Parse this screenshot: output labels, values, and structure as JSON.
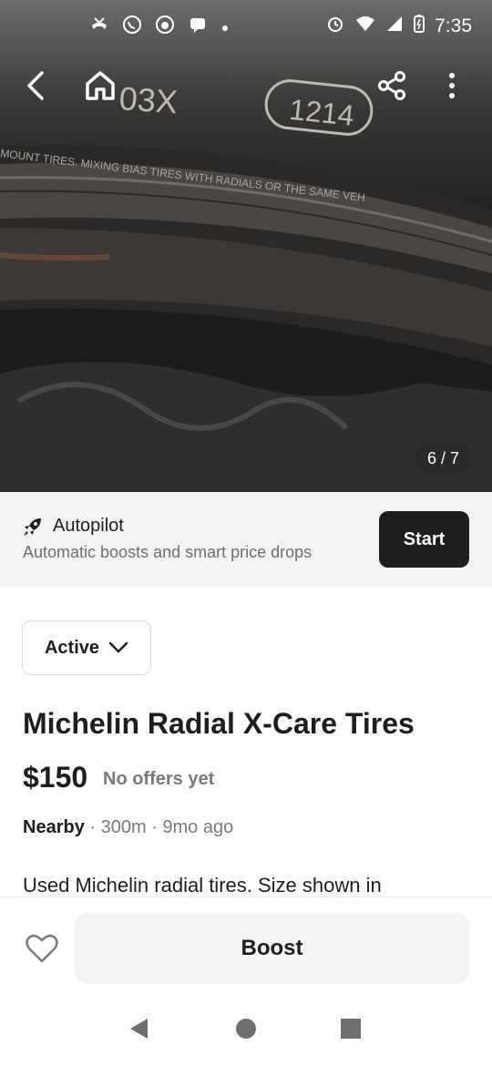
{
  "status_bar": {
    "time": "7:35",
    "icons_left": [
      "missed-call-icon",
      "whatsapp-icon",
      "app-icon",
      "chat-icon",
      "dot-icon"
    ],
    "icons_right": [
      "alarm-icon",
      "wifi-icon",
      "signal-icon",
      "battery-icon"
    ]
  },
  "gallery": {
    "counter": "6 / 7",
    "tire_text": {
      "code": "03X",
      "dot": "1214",
      "sidewall": "MOUNT TIRES. MIXING BIAS TIRES WITH RADIALS OR THE SAME VEH"
    }
  },
  "autopilot": {
    "title": "Autopilot",
    "subtitle": "Automatic boosts and smart price drops",
    "button": "Start"
  },
  "listing": {
    "status": "Active",
    "title": "Michelin Radial X-Care Tires",
    "price": "$150",
    "offers": "No offers yet",
    "location": "Nearby",
    "meta": " · 300m · 9mo ago",
    "description": "Used Michelin radial tires.  Size shown in"
  },
  "actions": {
    "boost": "Boost"
  },
  "colors": {
    "dark": "#1e1e1e",
    "muted": "#7a7a7a",
    "panel": "#f2f3f5"
  }
}
